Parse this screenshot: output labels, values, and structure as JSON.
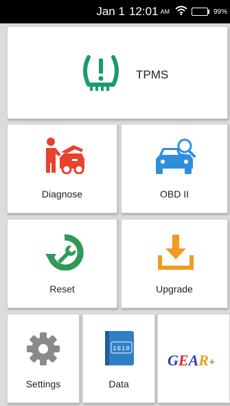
{
  "status_bar": {
    "date": "Jan 1",
    "time": "12:01",
    "ampm": "AM",
    "battery": "99%",
    "battery_level": 0.99,
    "battery_color": "#19c64a"
  },
  "tiles": {
    "tpms": {
      "label": "TPMS",
      "icon": "tire-pressure-warning-icon",
      "color": "#1a9b6c"
    },
    "diagnose": {
      "label": "Diagnose",
      "icon": "mechanic-car-icon",
      "color": "#e8412c"
    },
    "obd": {
      "label": "OBD II",
      "icon": "car-search-icon",
      "color": "#2f8fdc"
    },
    "reset": {
      "label": "Reset",
      "icon": "wrench-reset-icon",
      "color": "#2e9a57"
    },
    "upgrade": {
      "label": "Upgrade",
      "icon": "download-icon",
      "color": "#f39a21"
    },
    "settings": {
      "label": "Settings",
      "icon": "gear-icon",
      "color": "#8a8a8a"
    },
    "data": {
      "label": "Data",
      "icon": "data-file-icon",
      "text": "1010",
      "color": "#2f7fc6"
    },
    "gear_plus": {
      "logo": "GEAR+"
    }
  }
}
